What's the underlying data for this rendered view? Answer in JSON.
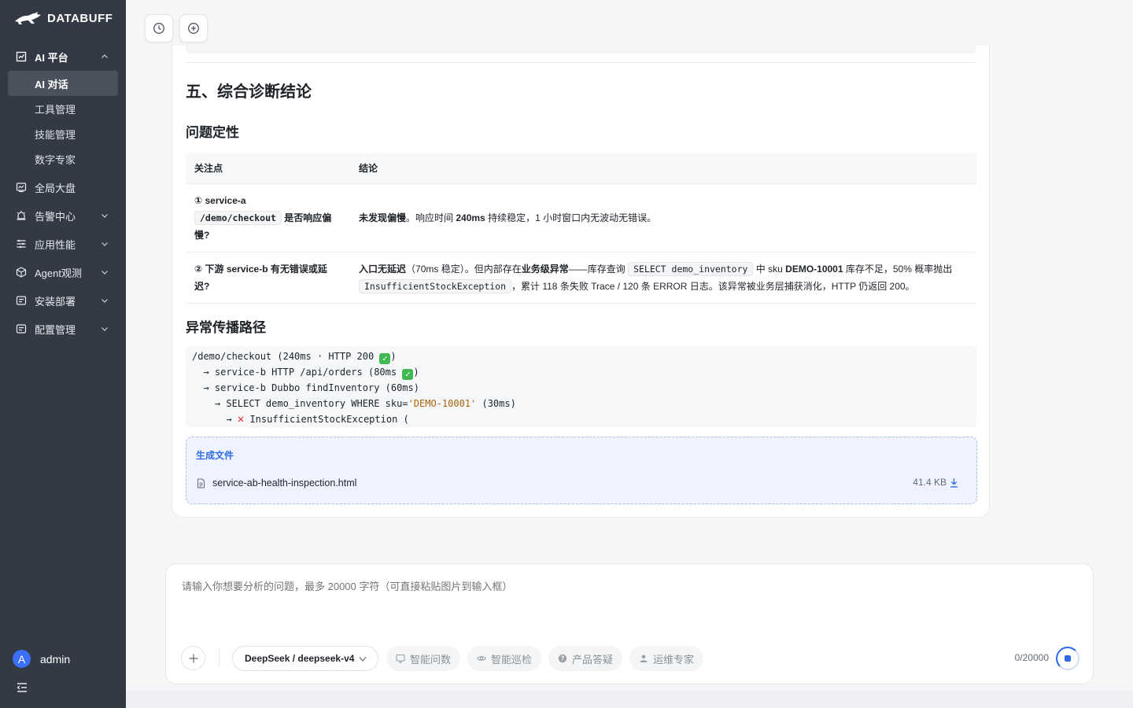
{
  "brand": {
    "name": "DATABUFF"
  },
  "sidebar": {
    "ai_platform": "AI 平台",
    "sub_items": [
      "AI 对话",
      "工具管理",
      "技能管理",
      "数字专家"
    ],
    "items": [
      {
        "label": "全局大盘",
        "icon": "dashboard-icon"
      },
      {
        "label": "告警中心",
        "icon": "alarm-icon"
      },
      {
        "label": "应用性能",
        "icon": "apm-icon"
      },
      {
        "label": "Agent观测",
        "icon": "cube-icon"
      },
      {
        "label": "安装部署",
        "icon": "deploy-icon"
      },
      {
        "label": "配置管理",
        "icon": "config-icon"
      }
    ],
    "user": {
      "initial": "A",
      "name": "admin"
    }
  },
  "report": {
    "section_title": "五、综合诊断结论",
    "subsection_problem": "问题定性",
    "table": {
      "headers": [
        "关注点",
        "结论"
      ],
      "row1": {
        "c1_a": "① service-a",
        "c1_code": "/demo/checkout",
        "c1_b": "是否响应偏慢?",
        "c2_bold1": "未发现偏慢",
        "c2_t1": "。响应时间 ",
        "c2_bold2": "240ms",
        "c2_t2": " 持续稳定，1 小时窗口内无波动无错误。"
      },
      "row2": {
        "c1": "② 下游 service-b 有无错误或延迟?",
        "c2_bold1": "入口无延迟",
        "c2_t1": "（70ms 稳定）。但内部存在",
        "c2_bold2": "业务级异常",
        "c2_t2": "——库存查询 ",
        "c2_code1": "SELECT demo_inventory",
        "c2_t3": " 中 sku ",
        "c2_bold3": "DEMO-10001",
        "c2_t4": " 库存不足，50% 概率抛出 ",
        "c2_code2": "InsufficientStockException",
        "c2_t5": "，累计 118 条失败 Trace / 120 条 ERROR 日志。该异常被业务层捕获消化，HTTP 仍返回 200。"
      }
    },
    "subsection_path": "异常传播路径",
    "code_lines": {
      "l1": "/demo/checkout (240ms · HTTP 200 ",
      "l1_end": ")",
      "l2": "  → service-b HTTP /api/orders (80ms ",
      "l2_end": ")",
      "l3": "  → service-b Dubbo findInventory (60ms)",
      "l4_a": "    → SELECT demo_inventory WHERE sku=",
      "l4_str": "'DEMO-10001'",
      "l4_b": " (30ms)",
      "l5_a": "      → ",
      "l5_b": " InsufficientStockException ("
    },
    "files": {
      "title": "生成文件",
      "items": [
        {
          "name": "service-ab-health-inspection.html",
          "size": "41.4 KB"
        }
      ]
    }
  },
  "composer": {
    "placeholder": "请输入你想要分析的问题，最多 20000 字符（可直接粘贴图片到输入框）",
    "model": "DeepSeek / deepseek-v4",
    "chips": [
      "智能问数",
      "智能巡检",
      "产品答疑",
      "运维专家"
    ],
    "counter": "0/20000"
  },
  "colors": {
    "sidebar_bg": "#333a45",
    "accent": "#2f6be8",
    "error": "#e0312b",
    "ok": "#3fb950"
  }
}
